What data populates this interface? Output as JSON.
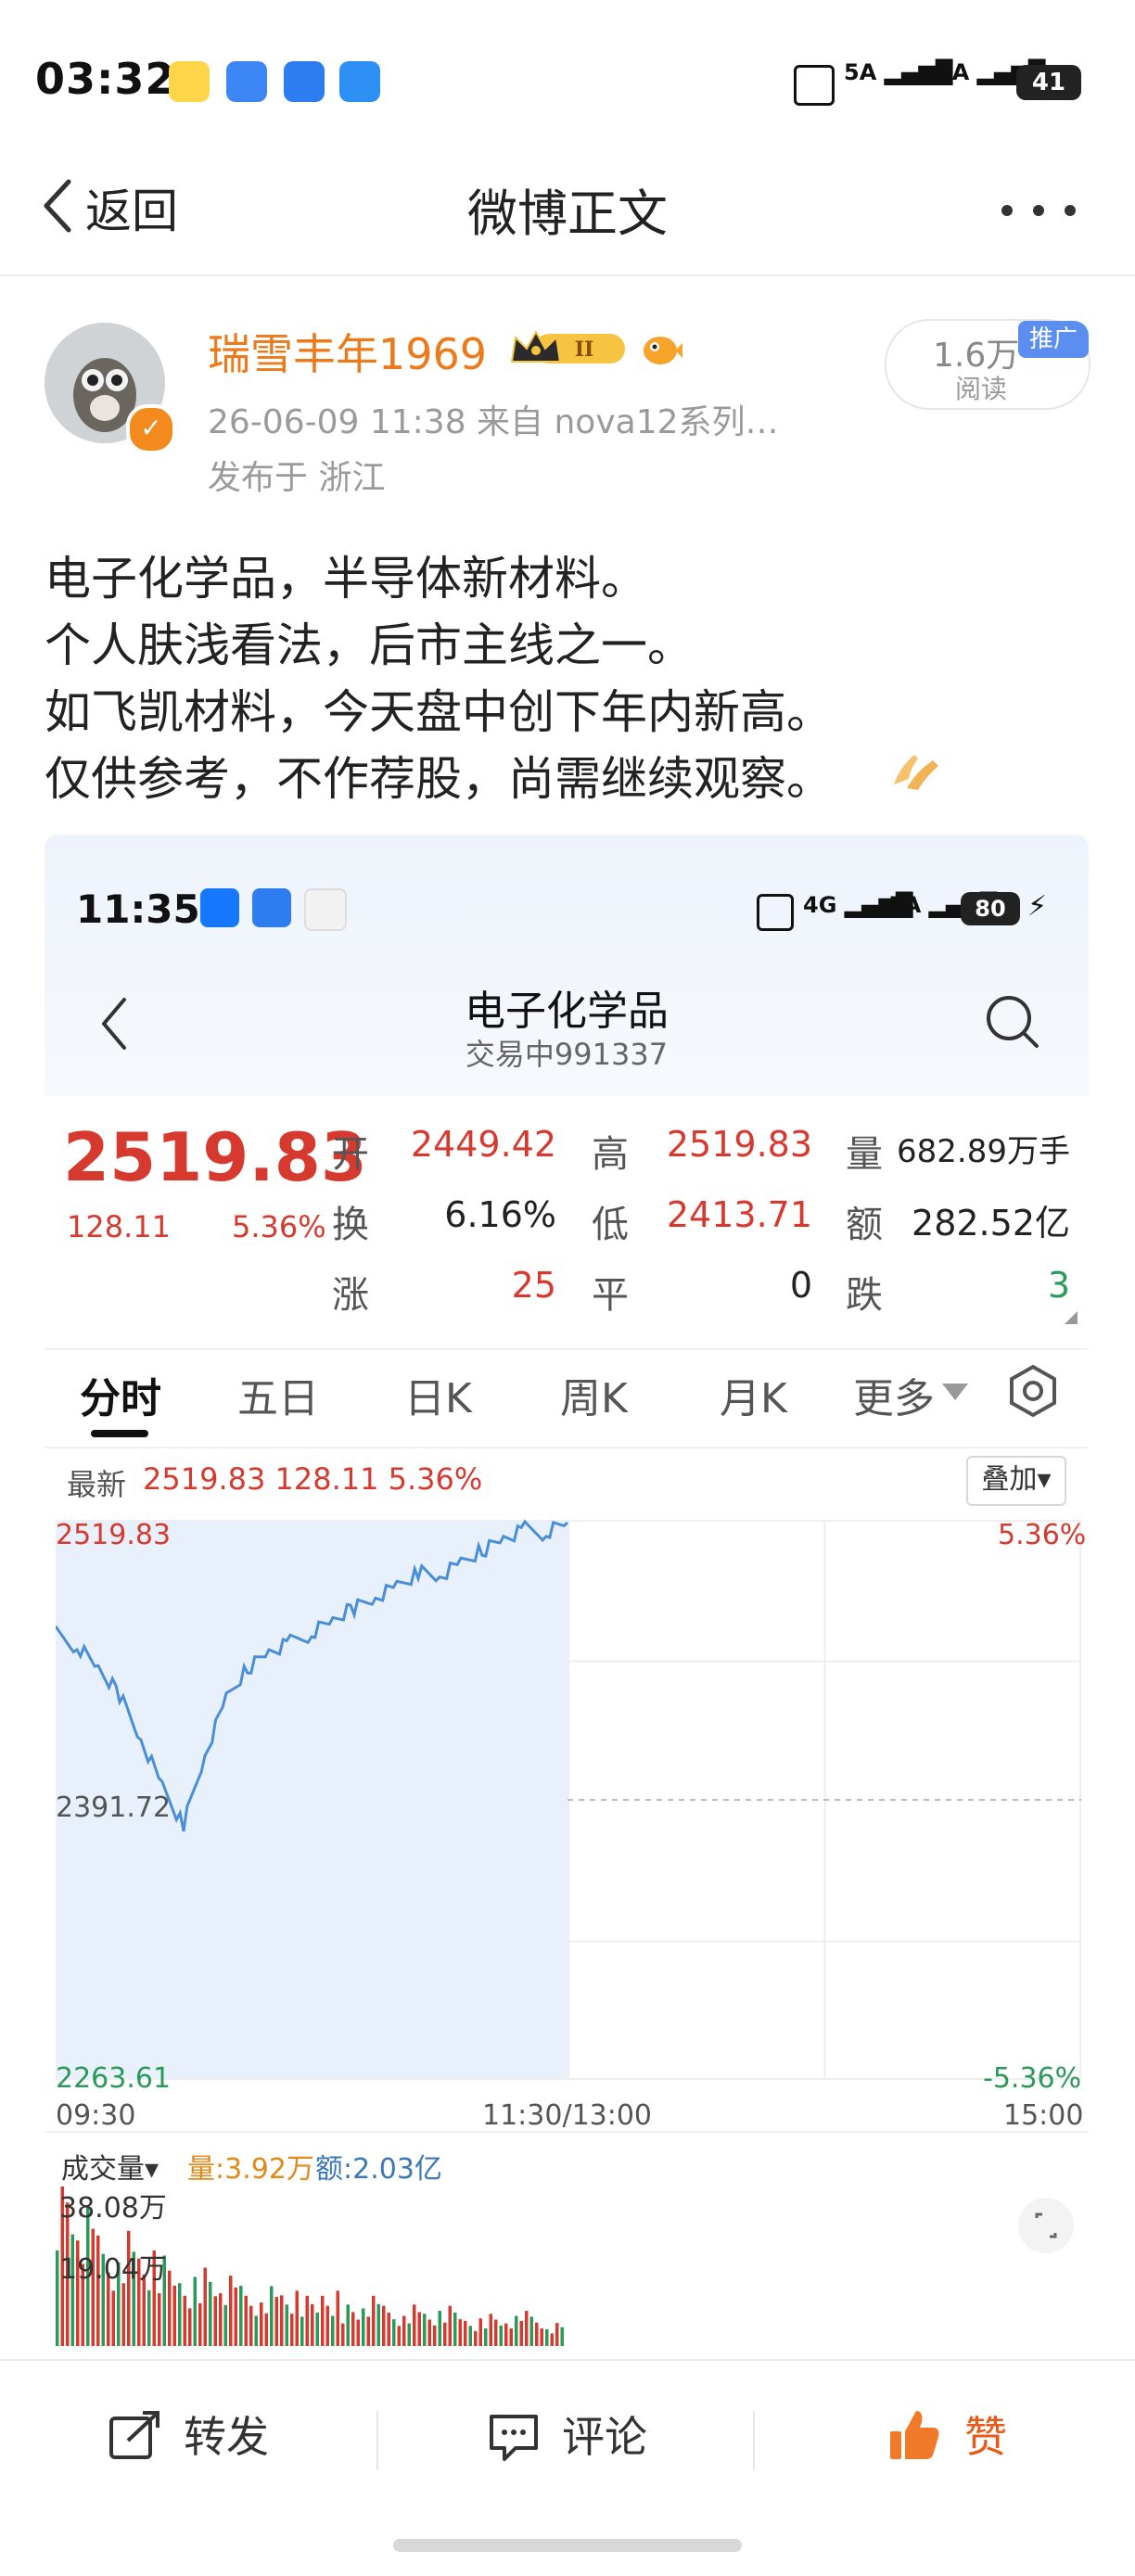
{
  "status_bar": {
    "time": "03:32",
    "signal_1": "5A",
    "signal_2": "5A",
    "battery": "41",
    "icons": [
      "weibo-app-icon",
      "message-icon",
      "bluetooth-app-icon",
      "shield-icon",
      "nfc-icon",
      "signal-icon",
      "battery-icon"
    ]
  },
  "nav": {
    "back_label": "返回",
    "title": "微博正文",
    "more_icon": "more-dots-icon"
  },
  "author": {
    "name": "瑞雪丰年1969",
    "badge_level": "II",
    "meta": "26-06-09 11:38  来自 nova12系列…",
    "location": "发布于 浙江",
    "read_count": "1.6万",
    "read_label": "阅读",
    "promo": "推广"
  },
  "post": {
    "lines": [
      "电子化学品，半导体新材料。",
      "个人肤浅看法，后市主线之一。",
      "如飞凯材料，今天盘中创下年内新高。",
      "仅供参考，不作荐股，尚需继续观察。"
    ],
    "emoji_icon": "pray-hands-icon"
  },
  "embed": {
    "status_time": "11:35",
    "status_4g": "4G",
    "status_5a": "5A",
    "status_battery": "80",
    "title": "电子化学品",
    "subtitle": "交易中991337",
    "price": "2519.83",
    "change": "128.11",
    "change_pct": "5.36%",
    "quote": {
      "open_label": "开",
      "open": "2449.42",
      "high_label": "高",
      "high": "2519.83",
      "vol_label": "量",
      "vol": "682.89万手",
      "turn_label": "换",
      "turn": "6.16%",
      "low_label": "低",
      "low": "2413.71",
      "amt_label": "额",
      "amt": "282.52亿",
      "up_label": "涨",
      "up": "25",
      "flat_label": "平",
      "flat": "0",
      "down_label": "跌",
      "down": "3"
    },
    "tabs": [
      "分时",
      "五日",
      "日K",
      "周K",
      "月K",
      "更多"
    ],
    "latest_label": "最新",
    "latest_values": "2519.83  128.11  5.36%",
    "overlay_label": "叠加",
    "y_top": "2519.83",
    "y_mid": "2391.72",
    "y_bot": "2263.61",
    "pct_top": "5.36%",
    "pct_bot": "-5.36%",
    "x_start": "09:30",
    "x_mid": "11:30/13:00",
    "x_end": "15:00",
    "vol_dropdown": "成交量",
    "vol_q": "量:3.92万",
    "vol_amt": "额:2.03亿",
    "vol_hi": "38.08万",
    "vol_mid": "19.04万",
    "colors": {
      "up": "#d63a2f",
      "down": "#2a9a5a",
      "line": "#4a8fd6",
      "fill": "#e8f0fb"
    }
  },
  "chart_data": {
    "type": "line",
    "title": "",
    "ylim": [
      2263.61,
      2519.83
    ],
    "x": [
      "09:30",
      "09:35",
      "09:40",
      "09:45",
      "09:50",
      "09:55",
      "10:00",
      "10:05",
      "10:10",
      "10:15",
      "10:20",
      "10:25",
      "10:30",
      "10:35",
      "10:40",
      "10:45",
      "10:50",
      "10:55",
      "11:00",
      "11:05",
      "11:10",
      "11:15",
      "11:20",
      "11:25",
      "11:30"
    ],
    "values": [
      2468,
      2462,
      2452,
      2440,
      2420,
      2398,
      2380,
      2412,
      2438,
      2452,
      2460,
      2464,
      2468,
      2474,
      2480,
      2485,
      2490,
      2496,
      2494,
      2500,
      2506,
      2512,
      2516,
      2514,
      2519
    ],
    "volume": [
      38.08,
      28,
      22,
      25,
      19,
      18,
      15,
      17,
      14,
      12,
      13,
      11,
      10,
      12,
      9,
      10,
      8,
      9,
      7,
      8,
      6,
      7,
      6,
      7,
      5
    ]
  },
  "bottom_bar": {
    "repost": "转发",
    "comment": "评论",
    "like": "赞"
  }
}
